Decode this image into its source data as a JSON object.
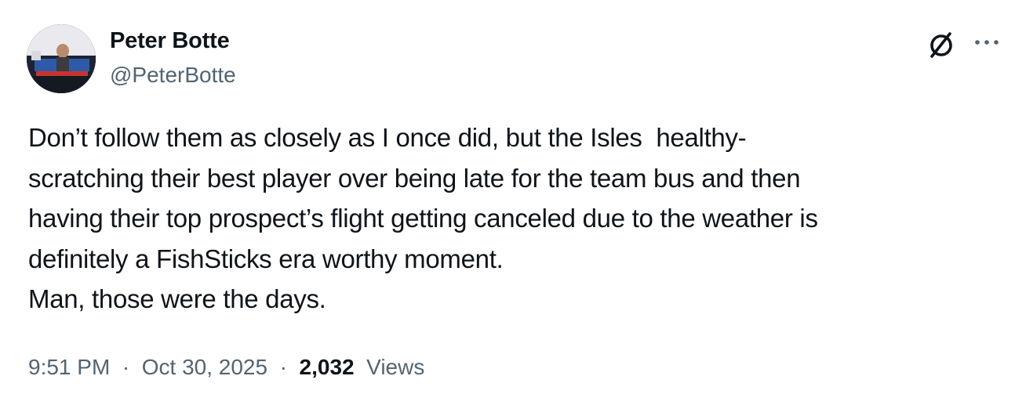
{
  "author": {
    "display_name": "Peter Botte",
    "handle": "@PeterBotte"
  },
  "icons": {
    "avatar": "profile-photo",
    "grok": "grok-slash-icon",
    "more": "more-dots-icon"
  },
  "tweet": {
    "lines": [
      "Don’t follow them as closely as I once did, but the Isles  healthy-",
      "scratching their best player over being late for the team bus and then",
      "having their top prospect’s flight getting canceled due to the weather is",
      "definitely a FishSticks era worthy moment.",
      "Man, those were the days."
    ]
  },
  "meta": {
    "time": "9:51 PM",
    "separator": "·",
    "date": "Oct 30, 2025",
    "views_count": "2,032",
    "views_label": "Views"
  },
  "colors": {
    "text_primary": "#0f1419",
    "text_secondary": "#536471",
    "background": "#ffffff"
  }
}
